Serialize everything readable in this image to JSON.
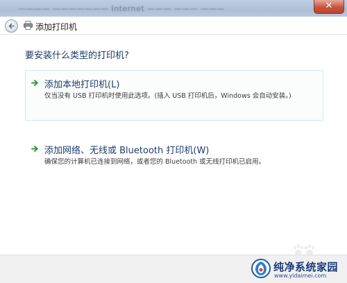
{
  "titlebar": {
    "blurred_text": "———— ——————— Internet ——— ——— ———",
    "close_label": "✕"
  },
  "nav": {
    "title": "添加打印机"
  },
  "content": {
    "question": "要安装什么类型的打印机?",
    "options": [
      {
        "title": "添加本地打印机(L)",
        "description": "仅当没有 USB 打印机时使用此选项。(插入 USB 打印机后，Windows 会自动安装。)",
        "selected": true
      },
      {
        "title": "添加网络、无线或 Bluetooth 打印机(W)",
        "description": "确保您的计算机已连接到网络，或者您的 Bluetooth 或无线打印机已启用。",
        "selected": false
      }
    ]
  },
  "watermark": {
    "brand": "纯净系统家园",
    "url": "www.yidaimei.com"
  },
  "colors": {
    "accent_arrow": "#2e9d3a",
    "title_text": "#1d3b6a",
    "footer_bg": "#f0f0f0"
  },
  "icons": {
    "back": "back-arrow-icon",
    "printer": "printer-icon",
    "option_arrow": "green-arrow-icon"
  }
}
